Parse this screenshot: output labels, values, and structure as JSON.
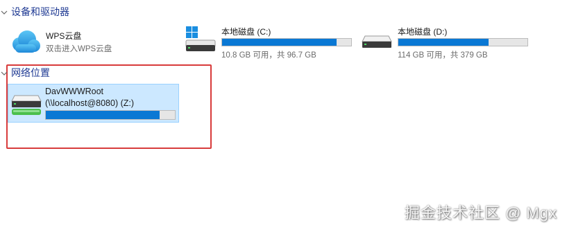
{
  "sections": {
    "devices": {
      "title": "设备和驱动器"
    },
    "network": {
      "title": "网络位置"
    }
  },
  "wps": {
    "name": "WPS云盘",
    "sub": "双击进入WPS云盘"
  },
  "drive_c": {
    "name": "本地磁盘 (C:)",
    "sub": "10.8 GB 可用，共 96.7 GB",
    "used_fraction": 0.888
  },
  "drive_d": {
    "name": "本地磁盘 (D:)",
    "sub": "114 GB 可用，共 379 GB",
    "used_fraction": 0.7
  },
  "net_drive": {
    "name": "DavWWWRoot",
    "path": "(\\\\localhost@8080) (Z:)",
    "used_fraction": 0.88
  },
  "watermark": "掘金技术社区 @ Mgx",
  "colors": {
    "accent": "#0a78d4",
    "header_text": "#1f3a93",
    "highlight": "#d83b3b",
    "selection": "#cce8ff"
  }
}
